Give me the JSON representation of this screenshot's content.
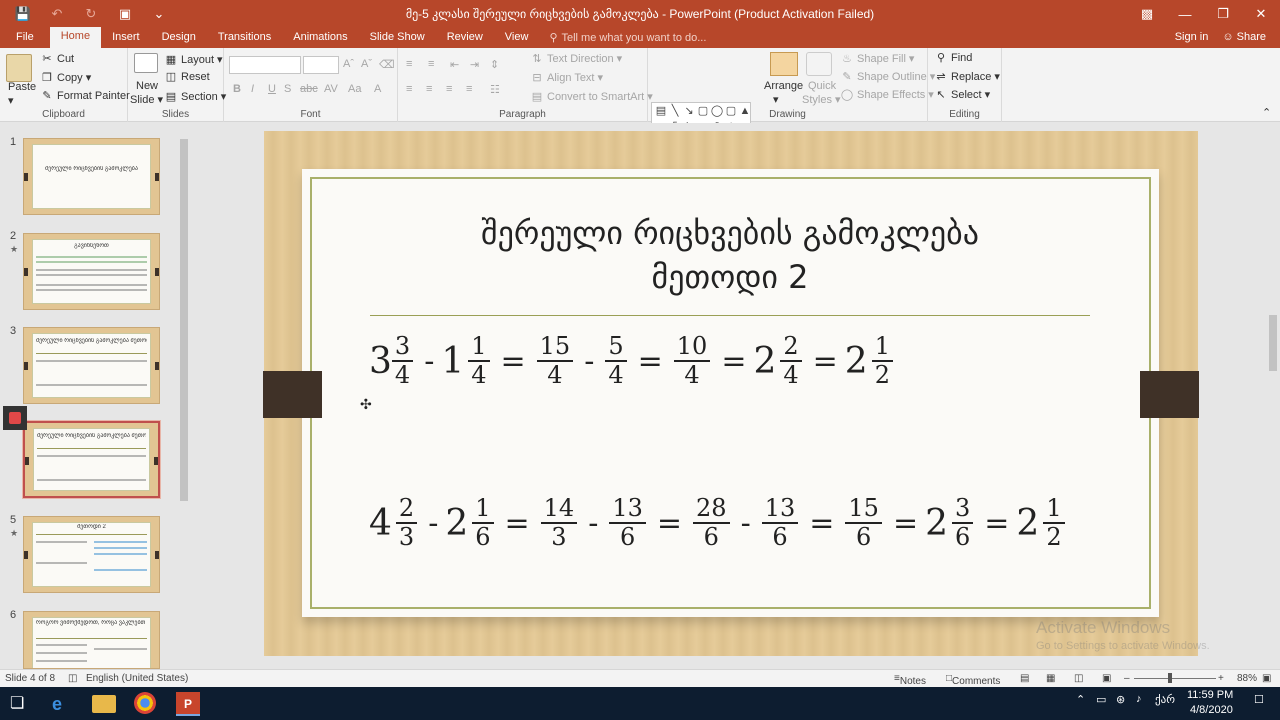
{
  "window": {
    "title": "მე-5 კლასი შერეული რიცხვების გამოკლება - PowerPoint (Product Activation Failed)"
  },
  "tabs": [
    "File",
    "Home",
    "Insert",
    "Design",
    "Transitions",
    "Animations",
    "Slide Show",
    "Review",
    "View"
  ],
  "tell_me": "Tell me what you want to do...",
  "sign_in": "Sign in",
  "share": "Share",
  "ribbon": {
    "clipboard": {
      "paste": "Paste",
      "cut": "Cut",
      "copy": "Copy",
      "format_painter": "Format Painter",
      "label": "Clipboard"
    },
    "slides": {
      "new_slide_line1": "New",
      "new_slide_line2": "Slide",
      "layout": "Layout",
      "reset": "Reset",
      "section": "Section",
      "label": "Slides"
    },
    "font": {
      "bold": "B",
      "italic": "I",
      "underline": "U",
      "strike": "S",
      "label": "Font"
    },
    "paragraph": {
      "text_direction": "Text Direction",
      "align_text": "Align Text",
      "smartart": "Convert to SmartArt",
      "label": "Paragraph"
    },
    "drawing": {
      "arrange": "Arrange",
      "quick_styles_1": "Quick",
      "quick_styles_2": "Styles",
      "shape_fill": "Shape Fill",
      "shape_outline": "Shape Outline",
      "shape_effects": "Shape Effects",
      "label": "Drawing"
    },
    "editing": {
      "find": "Find",
      "replace": "Replace",
      "select": "Select",
      "label": "Editing"
    }
  },
  "thumbnails": [
    {
      "num": "1",
      "title": "შერეული რიცხვების გამოკლება"
    },
    {
      "num": "2",
      "title": "გავიხსენოთ"
    },
    {
      "num": "3",
      "title": "შერეული რიცხვების გამოკლება მეთოდი 1"
    },
    {
      "num": "4",
      "title": "შერეული რიცხვების გამოკლება მეთოდი 2"
    },
    {
      "num": "5",
      "title": "მეთოდი 2"
    },
    {
      "num": "6",
      "title": "როგორ ვიმოქმედოთ, როცა ვაკლებთ შერეულს"
    }
  ],
  "slide": {
    "title_line1": "შერეული რიცხვების გამოკლება",
    "title_line2": "მეთოდი 2",
    "eq1": {
      "w1": "3",
      "n1": "3",
      "d1": "4",
      "op1": "-",
      "w2": "1",
      "n2": "1",
      "d2": "4",
      "op2": "=",
      "n3": "15",
      "d3": "4",
      "op3": "-",
      "n4": "5",
      "d4": "4",
      "op4": "=",
      "n5": "10",
      "d5": "4",
      "op5": "=",
      "w6": "2",
      "n6": "2",
      "d6": "4",
      "op6": "=",
      "w7": "2",
      "n7": "1",
      "d7": "2"
    },
    "eq2": {
      "w1": "4",
      "n1": "2",
      "d1": "3",
      "op1": "-",
      "w2": "2",
      "n2": "1",
      "d2": "6",
      "op2": "=",
      "n3": "14",
      "d3": "3",
      "op3": "-",
      "n4": "13",
      "d4": "6",
      "op4": "=",
      "n5": "28",
      "d5": "6",
      "op5": "-",
      "n6": "13",
      "d6": "6",
      "op6": "=",
      "n7": "15",
      "d7": "6",
      "op7": "=",
      "w8": "2",
      "n8": "3",
      "d8": "6",
      "op8": "=",
      "w9": "2",
      "n9": "1",
      "d9": "2"
    }
  },
  "watermark": {
    "line1": "Activate Windows",
    "line2": "Go to Settings to activate Windows."
  },
  "status": {
    "slide": "Slide 4 of 8",
    "language": "English (United States)",
    "notes": "Notes",
    "comments": "Comments",
    "zoom": "88%"
  },
  "taskbar": {
    "time": "11:59 PM",
    "date": "4/8/2020",
    "lang": "ქარ"
  },
  "colors": {
    "accent": "#b7472a",
    "wood": "#e4c893",
    "strap": "#3f3127"
  }
}
